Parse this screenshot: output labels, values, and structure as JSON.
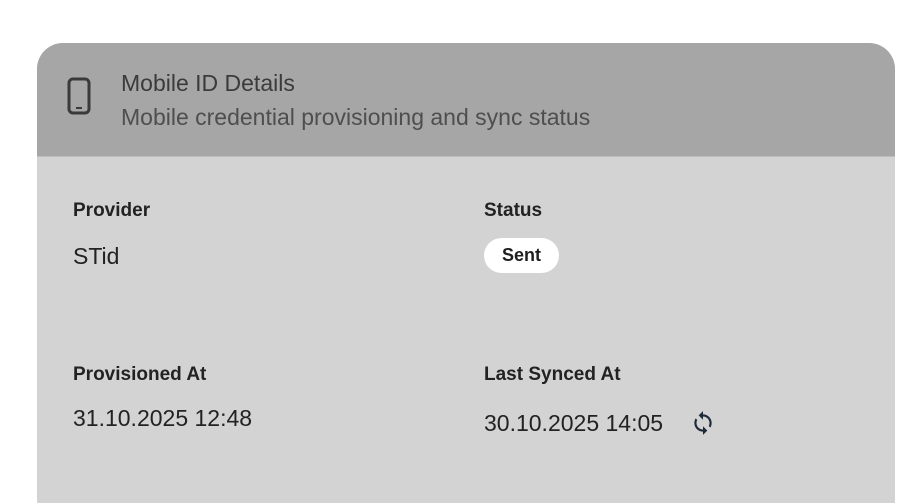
{
  "header": {
    "title": "Mobile ID Details",
    "subtitle": "Mobile credential provisioning and sync status",
    "icon": "phone-icon"
  },
  "fields": {
    "provider": {
      "label": "Provider",
      "value": "STid"
    },
    "status": {
      "label": "Status",
      "value": "Sent"
    },
    "provisioned_at": {
      "label": "Provisioned At",
      "value": "31.10.2025 12:48"
    },
    "last_synced_at": {
      "label": "Last Synced At",
      "value": "30.10.2025 14:05"
    }
  },
  "colors": {
    "header_bg": "#a6a6a6",
    "body_bg": "#d3d3d3",
    "badge_bg": "#ffffff",
    "icon_color": "#3a3a3a",
    "sync_icon_color": "#1e2a3a"
  },
  "icons": {
    "sync": "sync-icon"
  }
}
